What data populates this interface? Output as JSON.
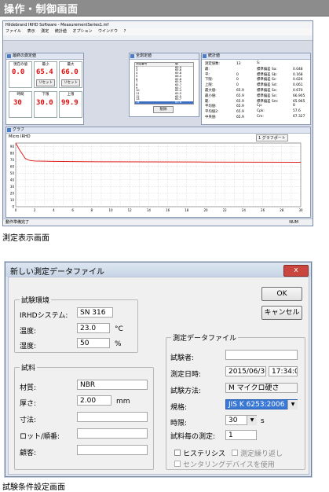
{
  "banner": {
    "title": "操作・制御画面"
  },
  "shot1": {
    "app_title": "Hildebrand IRHD Software - MeasurementSeries1.mf",
    "menu": [
      "ファイル",
      "表示",
      "測定",
      "統計値",
      "オプション",
      "ウインドウ",
      "?"
    ],
    "measure_window": {
      "title": "最終の測定値",
      "tiles": [
        {
          "label": "現在の値",
          "value": "0.0"
        },
        {
          "label": "最小",
          "value": "65.4"
        },
        {
          "label": "最大",
          "value": "66.0"
        }
      ],
      "reset_label": "リセット",
      "tiles2": [
        {
          "label": "時間",
          "value": "30"
        },
        {
          "label": "下限",
          "value": "30.0"
        },
        {
          "label": "上限",
          "value": "99.9"
        }
      ]
    },
    "all_values_window": {
      "title": "全測定値",
      "header": [
        "測定番号",
        "値"
      ],
      "rows": [
        [
          "2",
          "65.9"
        ],
        [
          "3",
          "65.6"
        ],
        [
          "4",
          "65.8"
        ],
        [
          "5",
          "66.0"
        ],
        [
          "6",
          "65.8"
        ],
        [
          "7",
          "65.9"
        ],
        [
          "8",
          "65.7"
        ],
        [
          "9",
          "65.7"
        ],
        [
          "10",
          "65.4"
        ],
        [
          "11",
          "65.5"
        ],
        [
          "12",
          "65.5"
        ],
        [
          "13",
          "65.7"
        ],
        [
          "14",
          "65.6"
        ]
      ],
      "delete_label": "削除"
    },
    "stats_window": {
      "title": "統計値",
      "col1": [
        [
          "測定値数:",
          "13"
        ],
        [
          "最:",
          ""
        ],
        [
          "平:",
          "0"
        ],
        [
          "下限:",
          "0"
        ],
        [
          "上限:",
          "0"
        ],
        [
          "最大値:",
          "65.9"
        ],
        [
          "最小値:",
          "65.9"
        ],
        [
          "範:",
          "65.9"
        ],
        [
          "平均値:",
          "65.9"
        ],
        [
          "平均値2:",
          "65.9"
        ],
        [
          "中央値:",
          "65.9"
        ]
      ],
      "col2": [
        [
          "S:",
          ""
        ],
        [
          "標準偏差 Sa:",
          "0.048"
        ],
        [
          "標準偏差 Sb:",
          "0.168"
        ],
        [
          "標準偏差 Sc:",
          "0.026"
        ],
        [
          "標準偏差 Sd:",
          "0.061"
        ],
        [
          "標準偏差 Se:",
          "0.670"
        ],
        [
          "標準偏差 Sn:",
          "66.905"
        ],
        [
          "標準偏差 Sm:",
          "65.965"
        ],
        [
          "Cp:",
          "8"
        ],
        [
          "Cpk:",
          "57.6"
        ],
        [
          "Cm:",
          "67.327"
        ]
      ]
    },
    "graph_window": {
      "title": "グラフ",
      "subtitle": "Micro IRHD",
      "legend": "1 グラフポート",
      "y_ticks": [
        "90",
        "80",
        "70",
        "60",
        "50",
        "40",
        "30",
        "20",
        "10",
        "0"
      ],
      "x_ticks": [
        "0",
        "2",
        "4",
        "6",
        "8",
        "10",
        "12",
        "14",
        "16",
        "18",
        "20",
        "22",
        "24",
        "26",
        "28",
        "30"
      ]
    },
    "status_left": "動作準備完了",
    "status_right": "NUM",
    "chart_data": {
      "type": "line",
      "x_range": [
        0,
        30
      ],
      "y_range": [
        0,
        95
      ],
      "series": [
        {
          "values": [
            [
              0,
              95
            ],
            [
              0.4,
              85
            ],
            [
              1,
              72
            ],
            [
              1.5,
              68.8
            ],
            [
              2,
              68.2
            ],
            [
              4,
              67.6
            ],
            [
              6,
              67.3
            ],
            [
              10,
              67.0
            ],
            [
              14,
              66.8
            ],
            [
              20,
              66.6
            ],
            [
              26,
              66.4
            ],
            [
              30,
              66.3
            ]
          ]
        }
      ],
      "line_color": "#e02020"
    }
  },
  "caption1": "測定表示画面",
  "dialog": {
    "title": "新しい測定データファイル",
    "close_glyph": "x",
    "ok_label": "OK",
    "cancel_label": "キャンセル",
    "env": {
      "legend": "試験環境",
      "system_label": "IRHDシステム:",
      "system_value": "SN 316",
      "temp_label": "温度:",
      "temp_value": "23.0",
      "temp_unit": "°C",
      "humidity_label": "湿度:",
      "humidity_value": "50",
      "humidity_unit": "%"
    },
    "sample": {
      "legend": "試料",
      "material_label": "材質:",
      "material_value": "NBR",
      "thickness_label": "厚さ:",
      "thickness_value": "2.00",
      "thickness_unit": "mm",
      "dimension_label": "寸法:",
      "dimension_value": "",
      "lot_label": "ロット/順番:",
      "lot_value": "",
      "customer_label": "顧客:",
      "customer_value": ""
    },
    "file": {
      "legend": "測定データファイル",
      "tester_label": "試験者:",
      "tester_value": "",
      "datetime_label": "測定日時:",
      "date_value": "2015/06/30",
      "time_value": "17:34:00",
      "method_label": "試験方法:",
      "method_value": "M マイクロ硬さ",
      "standard_label": "規格:",
      "standard_value": "JIS K 6253:2006",
      "timelimit_label": "時限:",
      "timelimit_value": "30",
      "timelimit_unit": "s",
      "count_label": "試料毎の測定:",
      "count_value": "1",
      "hysteresis_label": "ヒステリシス",
      "repeat_label": "測定繰り返し",
      "centering_label": "センタリングデバイスを使用"
    }
  },
  "caption2": "試験条件設定画面"
}
